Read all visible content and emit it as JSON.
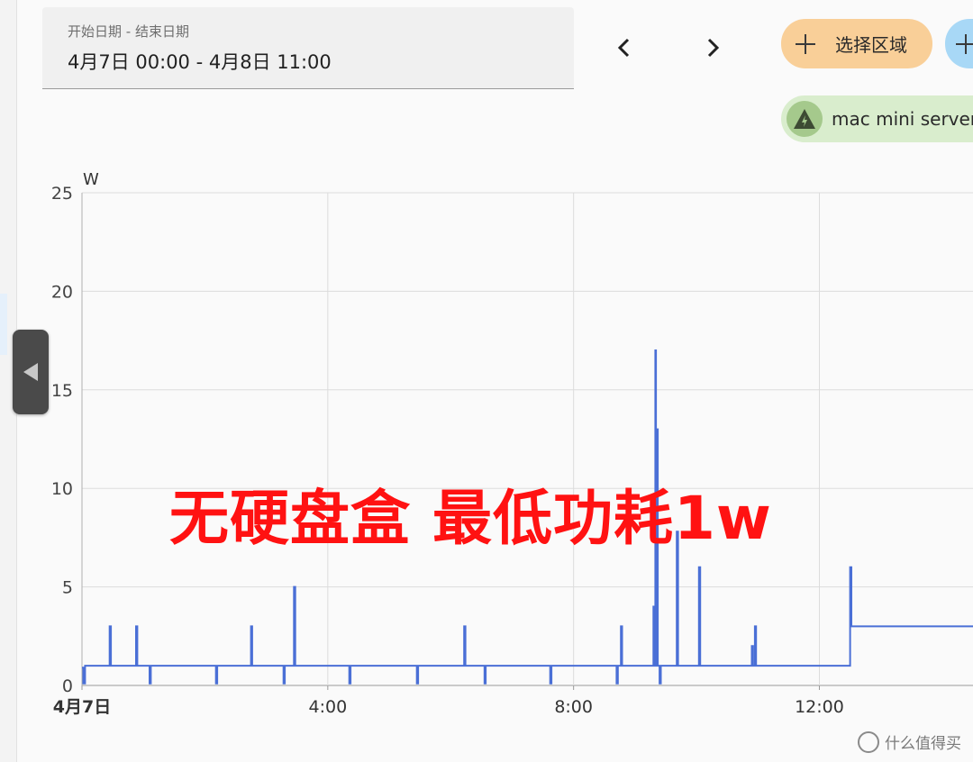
{
  "date_range": {
    "label": "开始日期 - 结束日期",
    "value": "4月7日 00:00 - 4月8日 11:00"
  },
  "nav": {
    "prev_icon": "chevron-left-icon",
    "next_icon": "chevron-right-icon"
  },
  "chips": {
    "area_label": "选择区域",
    "area_icon": "plus-icon",
    "add_icon": "plus-icon",
    "device_label": "mac mini server",
    "device_icon": "flash-triangle-icon"
  },
  "colors": {
    "line": "#4a6fd6",
    "area_chip": "#f9cf98",
    "add_chip": "#a8d8f6",
    "device_chip": "#d9edcd",
    "caption": "#ff1212"
  },
  "overlay_caption": "无硬盘盒 最低功耗1w",
  "watermark": "什么值得买",
  "chart_data": {
    "type": "line",
    "ylabel": "W",
    "ylim": [
      0,
      25
    ],
    "yticks": [
      0,
      5,
      10,
      15,
      20,
      25
    ],
    "xlim": [
      0,
      14.5
    ],
    "xticks": [
      {
        "value": 0,
        "label": "4月7日",
        "bold": true
      },
      {
        "value": 4,
        "label": "4:00"
      },
      {
        "value": 8,
        "label": "8:00"
      },
      {
        "value": 12,
        "label": "12:00"
      }
    ],
    "grid": true,
    "series": [
      {
        "x": [
          0,
          0.02,
          0.02,
          0.05,
          0.05,
          0.45,
          0.45,
          0.47,
          0.47,
          0.88,
          0.88,
          0.9,
          0.9,
          1.1,
          1.1,
          1.12,
          1.12,
          2.18,
          2.18,
          2.2,
          2.2,
          2.75,
          2.75,
          2.77,
          2.77,
          3.28,
          3.28,
          3.3,
          3.3,
          3.45,
          3.45,
          3.47,
          3.47,
          4.35,
          4.35,
          4.37,
          4.37,
          5.45,
          5.45,
          5.47,
          5.47,
          6.22,
          6.22,
          6.24,
          6.24,
          6.55,
          6.55,
          6.57,
          6.57,
          7.62,
          7.62,
          7.64,
          7.64,
          8.7,
          8.7,
          8.72,
          8.72,
          8.77,
          8.77,
          8.79,
          8.79,
          9.3,
          9.3,
          9.32,
          9.32,
          9.33,
          9.33,
          9.34,
          9.34,
          9.35,
          9.35,
          9.37,
          9.37,
          9.4,
          9.4,
          9.42,
          9.42,
          9.68,
          9.68,
          9.7,
          9.7,
          10.04,
          10.04,
          10.06,
          10.06,
          10.9,
          10.9,
          10.92,
          10.92,
          10.95,
          10.95,
          10.97,
          10.97,
          12.5,
          12.5,
          12.52,
          12.52,
          14.5
        ],
        "y": [
          0.9,
          0.9,
          0.1,
          0.1,
          1,
          1,
          3,
          3,
          1,
          1,
          3,
          3,
          1,
          1,
          0.1,
          0.1,
          1,
          1,
          0.1,
          0.1,
          1,
          1,
          3,
          3,
          1,
          1,
          0.1,
          0.1,
          1,
          1,
          5,
          5,
          1,
          1,
          0.1,
          0.1,
          1,
          1,
          0.1,
          0.1,
          1,
          1,
          3,
          3,
          1,
          1,
          0.1,
          0.1,
          1,
          1,
          0.1,
          0.1,
          1,
          1,
          0.1,
          0.1,
          1,
          1,
          3,
          3,
          1,
          1,
          4,
          4,
          1,
          1,
          17,
          17,
          1,
          1,
          13,
          13,
          1,
          1,
          0.1,
          0.1,
          1,
          1,
          7.8,
          7.8,
          1,
          1,
          6,
          6,
          1,
          1,
          2,
          2,
          1,
          1,
          3,
          3,
          1,
          1,
          6,
          6,
          3,
          3
        ]
      }
    ]
  }
}
